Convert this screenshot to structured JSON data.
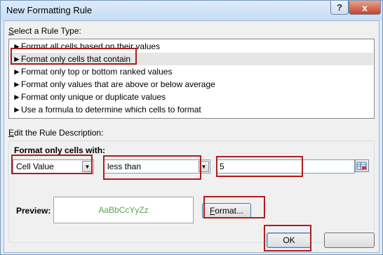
{
  "window": {
    "title": "New Formatting Rule",
    "help_glyph": "?",
    "close_glyph": "x"
  },
  "rule_type": {
    "label": "Select a Rule Type:",
    "label_accel": "S",
    "label_rest": "elect a Rule Type:",
    "arrow_glyph": "►",
    "items": [
      "Format all cells based on their values",
      "Format only cells that contain",
      "Format only top or bottom ranked values",
      "Format only values that are above or below average",
      "Format only unique or duplicate values",
      "Use a formula to determine which cells to format"
    ],
    "selected_index": 1
  },
  "description": {
    "label": "Edit the Rule Description:",
    "label_accel": "E",
    "label_rest": "dit the Rule Description:",
    "format_only_label": "Format only cells with:",
    "format_only_accel": "O",
    "condition_type": "Cell Value",
    "operator": "less than",
    "value": "5",
    "preview_label": "Preview:",
    "preview_sample": "AaBbCcYyZz",
    "preview_sample_color": "#5aa64a",
    "format_button": "Format...",
    "format_accel": "F",
    "format_rest": "ormat..."
  },
  "buttons": {
    "ok": "OK"
  },
  "colors": {
    "highlight": "#b01c1c",
    "title_bar": "#dcebf8",
    "close_button": "#c4432a"
  }
}
